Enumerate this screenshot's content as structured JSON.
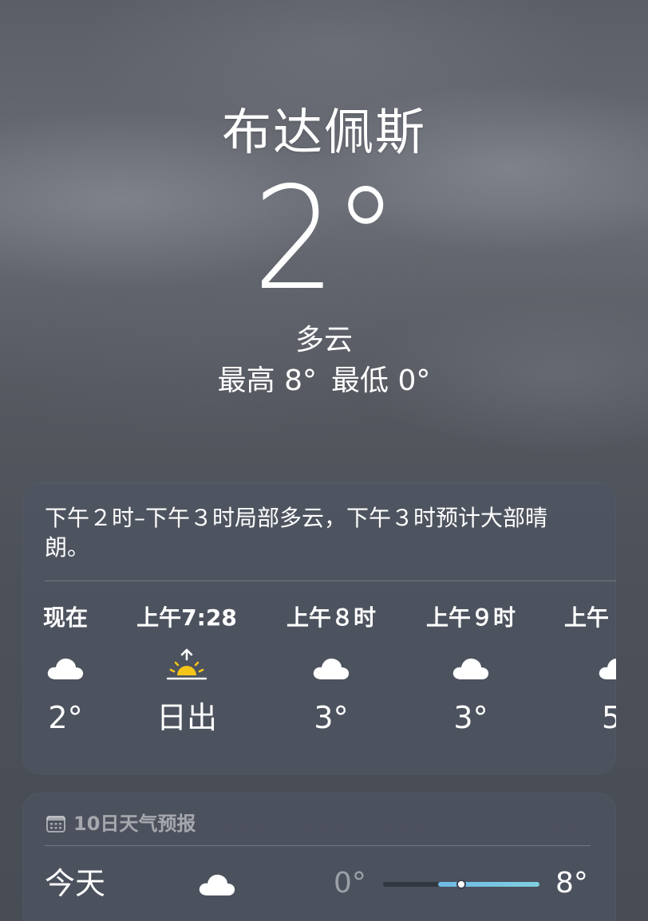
{
  "location": {
    "city": "布达佩斯",
    "temperature": "2°",
    "condition": "多云",
    "high": "最高 8°",
    "low": "最低 0°"
  },
  "hourly": {
    "summary": "下午２时–下午３时局部多云，下午３时预计大部晴朗。",
    "items": [
      {
        "time": "现在",
        "icon": "cloud-icon",
        "value": "2°"
      },
      {
        "time": "上午7:28",
        "icon": "sunrise-icon",
        "value": "日出"
      },
      {
        "time": "上午８时",
        "icon": "cloud-icon",
        "value": "3°"
      },
      {
        "time": "上午９时",
        "icon": "cloud-icon",
        "value": "3°"
      },
      {
        "time": "上午",
        "icon": "cloud-icon",
        "value": "5"
      }
    ]
  },
  "forecast": {
    "header": "10日天气预报",
    "days": [
      {
        "day": "今天",
        "icon": "cloud-icon",
        "low": "0°",
        "high": "8°",
        "current_fraction": 0.5,
        "range_start_fraction": 0.35,
        "range_end_fraction": 1.0
      }
    ]
  },
  "colors": {
    "range_fill": "#6fb9e6",
    "sun": "#f5c518"
  }
}
